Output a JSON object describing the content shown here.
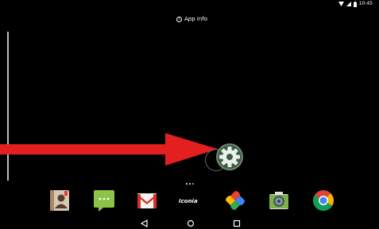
{
  "status_bar": {
    "time": "10:45",
    "icons": [
      "wifi-icon",
      "signal-icon",
      "battery-icon"
    ]
  },
  "app_info": {
    "label": "App info",
    "icon": "info-icon"
  },
  "dragged_app": {
    "icon": "settings-icon",
    "color": "#5b7f62"
  },
  "annotation": {
    "arrow_color": "#e41f1f"
  },
  "dock": {
    "apps": [
      {
        "name": "contacts-icon"
      },
      {
        "name": "messenger-icon"
      },
      {
        "name": "gmail-icon"
      },
      {
        "name": "iconia-icon",
        "label": "Iconia"
      },
      {
        "name": "photos-icon"
      },
      {
        "name": "camera-icon"
      },
      {
        "name": "chrome-icon"
      }
    ]
  },
  "nav_bar": {
    "buttons": [
      "back-icon",
      "home-icon",
      "recents-icon"
    ]
  }
}
